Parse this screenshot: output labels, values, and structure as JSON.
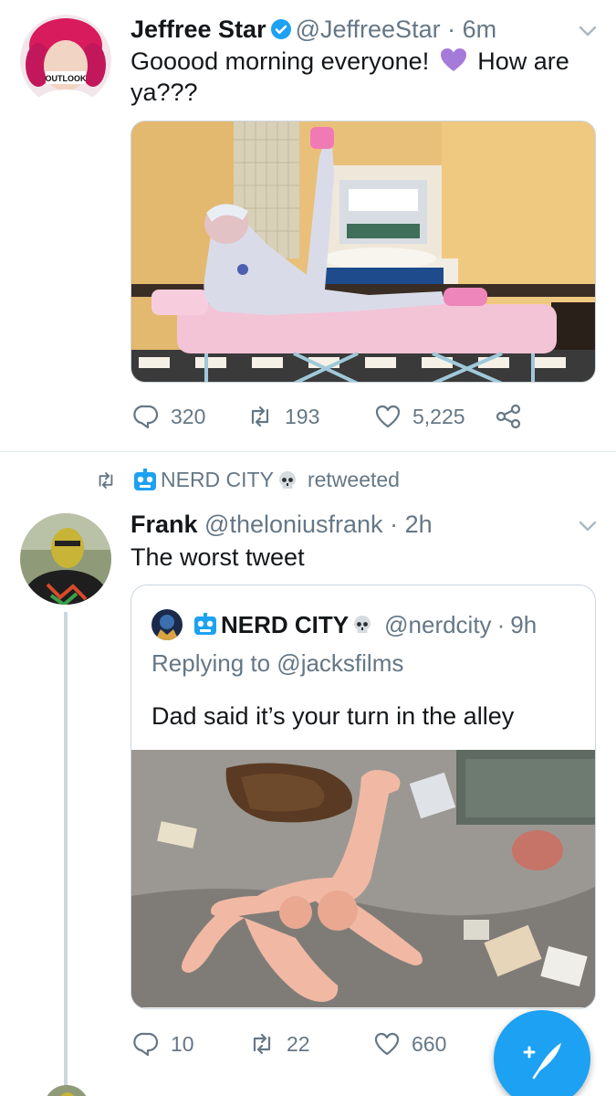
{
  "tweet1": {
    "display_name": "Jeffree Star",
    "handle": "@JeffreeStar",
    "separator": "·",
    "time": "6m",
    "text_part1": "Gooood morning everyone!",
    "emoji_icon": "purple-heart-icon",
    "text_part2": "How are",
    "text_line2": "ya???",
    "replies": "320",
    "retweets": "193",
    "likes": "5,225"
  },
  "retweet_context": {
    "retweeter": "NERD CITY",
    "label": "retweeted"
  },
  "tweet2": {
    "display_name": "Frank",
    "handle": "@theloniusfrank",
    "separator": "·",
    "time": "2h",
    "text": "The worst tweet",
    "quoted": {
      "display_name": "NERD CITY",
      "handle": "@nerdcity",
      "separator": "·",
      "time": "9h",
      "replying_to": "Replying to @jacksfilms",
      "text": "Dad said it’s your turn in the alley"
    },
    "replies": "10",
    "retweets": "22",
    "likes": "660"
  },
  "colors": {
    "accent": "#1da1f2",
    "secondary_text": "#657786",
    "primary_text": "#14171a",
    "border": "#e1e8ed"
  }
}
